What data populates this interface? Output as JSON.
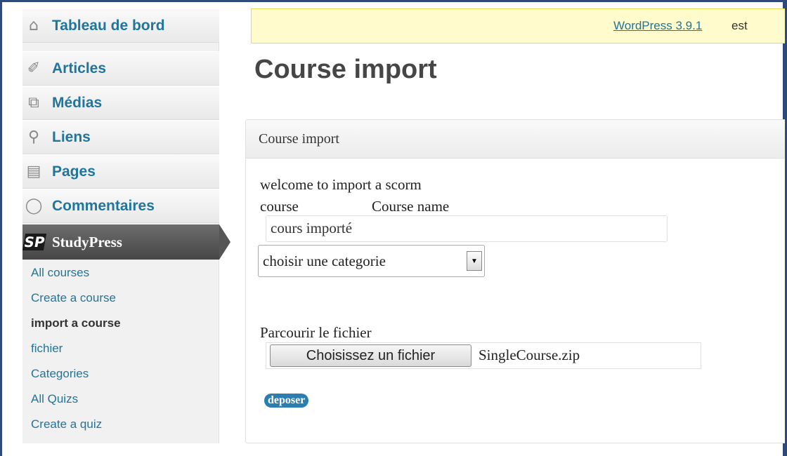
{
  "sidebar": {
    "items": [
      {
        "icon": "dashboard-icon",
        "glyph": "⌂",
        "label": "Tableau de bord"
      },
      {
        "icon": "pin-icon",
        "glyph": "✐",
        "label": "Articles"
      },
      {
        "icon": "media-icon",
        "glyph": "⧉",
        "label": "Médias"
      },
      {
        "icon": "link-icon",
        "glyph": "⚲",
        "label": "Liens"
      },
      {
        "icon": "pages-icon",
        "glyph": "▤",
        "label": "Pages"
      },
      {
        "icon": "comment-icon",
        "glyph": "◯",
        "label": "Commentaires"
      }
    ],
    "active": {
      "icon": "studypress-logo-icon",
      "glyph": "SP",
      "label": "StudyPress"
    },
    "submenu": [
      {
        "label": "All courses",
        "current": false
      },
      {
        "label": "Create a course",
        "current": false
      },
      {
        "label": "import a course",
        "current": true
      },
      {
        "label": "fichier",
        "current": false
      },
      {
        "label": "Categories",
        "current": false
      },
      {
        "label": "All Quizs",
        "current": false
      },
      {
        "label": "Create a quiz",
        "current": false
      }
    ]
  },
  "notice": {
    "link_text": "WordPress 3.9.1",
    "rest_text": "est"
  },
  "main": {
    "page_title": "Course import",
    "panel": {
      "title": "Course import",
      "welcome_text": "welcome to import a scorm",
      "course_label": "course",
      "course_name_label": "Course name",
      "course_name_value": "cours importé",
      "category_select_value": "choisir une categorie",
      "file_label": "Parcourir le fichier",
      "file_button_label": "Choisissez un fichier",
      "file_name": "SingleCourse.zip",
      "submit_label": "deposer"
    }
  },
  "colors": {
    "link": "#21759b",
    "notice_bg": "#fffbcc",
    "active_menu_bg": "#555555",
    "submit_bg": "#2a7fae",
    "frame_border": "#2e4a7a"
  }
}
